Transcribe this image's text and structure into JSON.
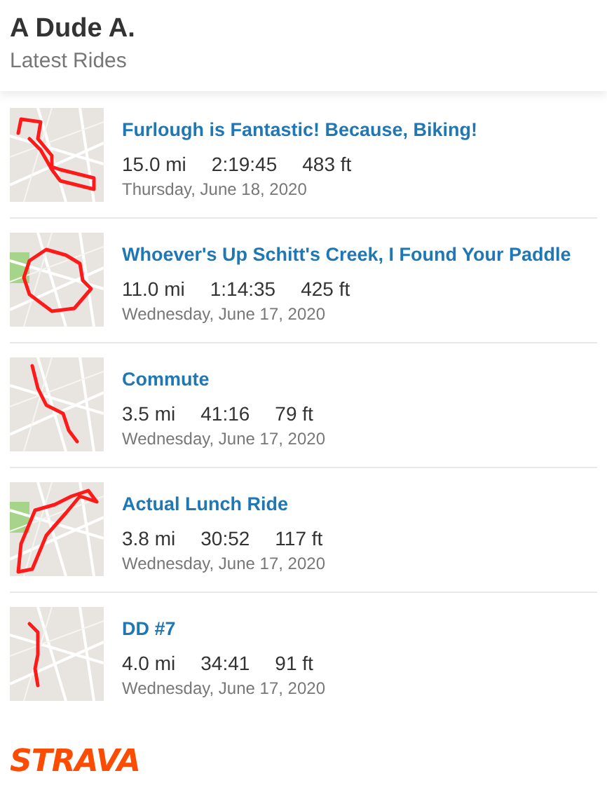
{
  "header": {
    "athlete": "A Dude A.",
    "subtitle": "Latest Rides"
  },
  "rides": [
    {
      "kind": "picture",
      "title": "Furlough is Fantastic! Because, Biking!",
      "distance": "15.0 mi",
      "time": "2:19:45",
      "elevation": "483 ft",
      "date": "Thursday, June 18, 2020"
    },
    {
      "kind": "picture",
      "title": "Whoever's Up Schitt's Creek, I Found Your Paddle",
      "distance": "11.0 mi",
      "time": "1:14:35",
      "elevation": "425 ft",
      "date": "Wednesday, June 17, 2020"
    },
    {
      "kind": "picture",
      "title": "Commute",
      "distance": "3.5 mi",
      "time": "41:16",
      "elevation": "79 ft",
      "date": "Wednesday, June 17, 2020"
    },
    {
      "kind": "picture",
      "title": "Actual Lunch Ride",
      "distance": "3.8 mi",
      "time": "30:52",
      "elevation": "117 ft",
      "date": "Wednesday, June 17, 2020"
    },
    {
      "kind": "picture",
      "title": "DD #7",
      "distance": "4.0 mi",
      "time": "34:41",
      "elevation": "91 ft",
      "date": "Wednesday, June 17, 2020"
    }
  ],
  "footer": {
    "logo": "STRAVA"
  }
}
